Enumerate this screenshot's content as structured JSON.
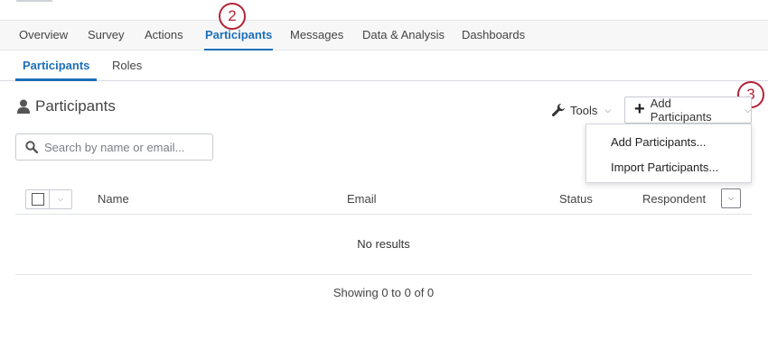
{
  "main_nav": {
    "tabs": [
      "Overview",
      "Survey",
      "Actions",
      "Participants",
      "Messages",
      "Data & Analysis",
      "Dashboards"
    ],
    "active": "Participants"
  },
  "sub_nav": {
    "tabs": [
      "Participants",
      "Roles"
    ],
    "active": "Participants"
  },
  "step_badges": [
    "2",
    "3"
  ],
  "page": {
    "title": "Participants",
    "title_icon": "person-icon"
  },
  "toolbar": {
    "tools_label": "Tools",
    "tools_icon": "wrench-icon",
    "add_label": "Add Participants",
    "add_icon": "plus-icon"
  },
  "add_menu": {
    "items": [
      "Add Participants...",
      "Import Participants..."
    ]
  },
  "search": {
    "placeholder": "Search by name or email...",
    "value": ""
  },
  "table": {
    "columns": [
      "Name",
      "Email",
      "Status",
      "Respondent"
    ],
    "rows": [],
    "empty_text": "No results"
  },
  "pagination": {
    "summary": "Showing 0 to 0 of 0"
  },
  "colors": {
    "accent": "#1d6fb8",
    "badge": "#b32336"
  }
}
